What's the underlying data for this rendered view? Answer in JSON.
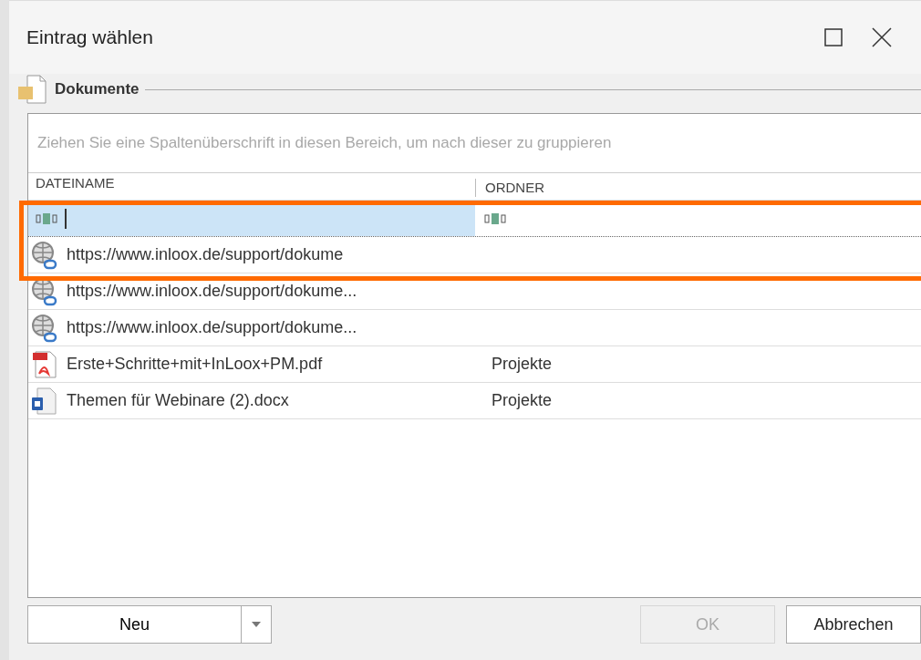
{
  "window": {
    "title": "Eintrag wählen"
  },
  "group": {
    "title": "Dokumente"
  },
  "grid": {
    "group_panel": "Ziehen Sie eine Spaltenüberschrift in diesen Bereich, um nach dieser zu gruppieren",
    "columns": [
      "DATEINAME",
      "ORDNER"
    ],
    "rows": [
      {
        "kind": "link",
        "name": "https://www.inloox.de/support/dokume",
        "folder": ""
      },
      {
        "kind": "link",
        "name": "https://www.inloox.de/support/dokume...",
        "folder": ""
      },
      {
        "kind": "link",
        "name": "https://www.inloox.de/support/dokume...",
        "folder": ""
      },
      {
        "kind": "pdf",
        "name": "Erste+Schritte+mit+InLoox+PM.pdf",
        "folder": "Projekte"
      },
      {
        "kind": "word",
        "name": "Themen für Webinare (2).docx",
        "folder": "Projekte"
      }
    ]
  },
  "buttons": {
    "new": "Neu",
    "ok": {
      "label": "OK",
      "disabled": true
    },
    "cancel": "Abbrechen"
  }
}
